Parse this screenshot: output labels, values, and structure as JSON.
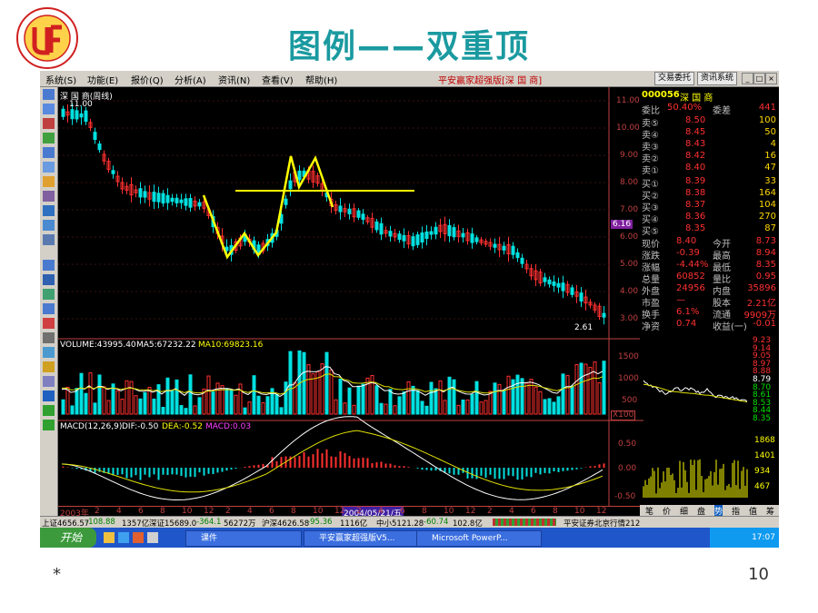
{
  "slide": {
    "title": "图例——双重顶",
    "star": "*",
    "page_number": "10"
  },
  "menu": [
    "系统(S)",
    "功能(E)",
    "报价(Q)",
    "分析(A)",
    "资讯(N)",
    "查看(V)",
    "帮助(H)"
  ],
  "app_title": "平安赢家超强版[深 国 商]",
  "buttons": {
    "trade": "交易委托",
    "info": "资讯系统"
  },
  "chart": {
    "header": "深 国 商(周线)",
    "high_label": "11.00",
    "low_label": "2.61",
    "price_axis": [
      "11.00",
      "10.00",
      "9.00",
      "8.00",
      "7.00",
      "6.00",
      "5.00",
      "4.00",
      "3.00"
    ],
    "current_tag": "6.16",
    "volume_header": "VOLUME:43995.40",
    "volume_ma5": "MA5:67232.22",
    "volume_ma10": "MA10:69823.16",
    "volume_axis": [
      "1500",
      "1000",
      "500",
      "X100"
    ],
    "macd_header": "MACD(12,26,9)",
    "macd_dif": "DIF:-0.50",
    "macd_dea": "DEA:-0.52",
    "macd_val": "MACD:0.03",
    "macd_axis": [
      "0.50",
      "0.00",
      "-0.50"
    ],
    "date_label": "2004/05/21/五",
    "xaxis_start": "2003年",
    "xaxis": [
      "2",
      "4",
      "6",
      "8",
      "10",
      "12",
      "2",
      "4",
      "6",
      "8",
      "10",
      "12",
      "2",
      "4",
      "6",
      "8",
      "10",
      "12",
      "2",
      "4",
      "6",
      "8",
      "10",
      "12"
    ]
  },
  "quote": {
    "code": "000056",
    "name": "深 国 商",
    "wb_label": "委比",
    "wb_value": "50.40%",
    "wc_label": "委差",
    "wc_value": "441",
    "sells": [
      {
        "label": "卖⑤",
        "price": "8.50",
        "vol": "100"
      },
      {
        "label": "卖④",
        "price": "8.45",
        "vol": "50"
      },
      {
        "label": "卖③",
        "price": "8.43",
        "vol": "4"
      },
      {
        "label": "卖②",
        "price": "8.42",
        "vol": "16"
      },
      {
        "label": "卖①",
        "price": "8.40",
        "vol": "47"
      }
    ],
    "buys": [
      {
        "label": "买①",
        "price": "8.39",
        "vol": "33"
      },
      {
        "label": "买②",
        "price": "8.38",
        "vol": "164"
      },
      {
        "label": "买③",
        "price": "8.37",
        "vol": "104"
      },
      {
        "label": "买④",
        "price": "8.36",
        "vol": "270"
      },
      {
        "label": "买⑤",
        "price": "8.35",
        "vol": "87"
      }
    ],
    "stats": [
      {
        "l1": "现价",
        "v1": "8.40",
        "l2": "今开",
        "v2": "8.73"
      },
      {
        "l1": "涨跌",
        "v1": "-0.39",
        "l2": "最高",
        "v2": "8.94"
      },
      {
        "l1": "涨幅",
        "v1": "-4.44%",
        "l2": "最低",
        "v2": "8.35"
      },
      {
        "l1": "总量",
        "v1": "60852",
        "l2": "量比",
        "v2": "0.95"
      },
      {
        "l1": "外盘",
        "v1": "24956",
        "l2": "内盘",
        "v2": "35896"
      },
      {
        "l1": "市盈",
        "v1": "—",
        "l2": "股本",
        "v2": "2.21亿"
      },
      {
        "l1": "换手",
        "v1": "6.1%",
        "l2": "流通",
        "v2": "9909万"
      },
      {
        "l1": "净资",
        "v1": "0.74",
        "l2": "收益(一)",
        "v2": "-0.01"
      }
    ],
    "mini_price_axis": [
      "9.23",
      "9.14",
      "9.05",
      "8.97",
      "8.88",
      "8.79",
      "8.70",
      "8.61",
      "8.53",
      "8.44",
      "8.35"
    ],
    "mini_vol_axis": [
      "1868",
      "1401",
      "934",
      "467"
    ],
    "tabs": [
      "笔",
      "价",
      "细",
      "盘",
      "势",
      "指",
      "值",
      "筹"
    ]
  },
  "statusbar": {
    "sh": "上证4656.57",
    "sh_chg": "-108.88",
    "sh_amt": "1357亿",
    "sz": "深证15689.0",
    "sz_chg": "-364.1",
    "sz_amt": "56272万",
    "hs": "沪深4626.58",
    "hs_chg": "-95.36",
    "hs_amt": "1116亿",
    "zx": "中小5121.28",
    "zx_chg": "-60.74",
    "zx_amt": "102.8亿",
    "broker": "平安证券北京行情212"
  },
  "taskbar": {
    "start": "开始",
    "tasks": [
      "课件",
      "平安赢家超强版V5...",
      "Microsoft PowerP..."
    ],
    "clock": "17:07"
  },
  "colors": {
    "up": "#ff3030",
    "down": "#00e0e0",
    "pattern": "#ffff00",
    "title": "#1a9aa0"
  }
}
